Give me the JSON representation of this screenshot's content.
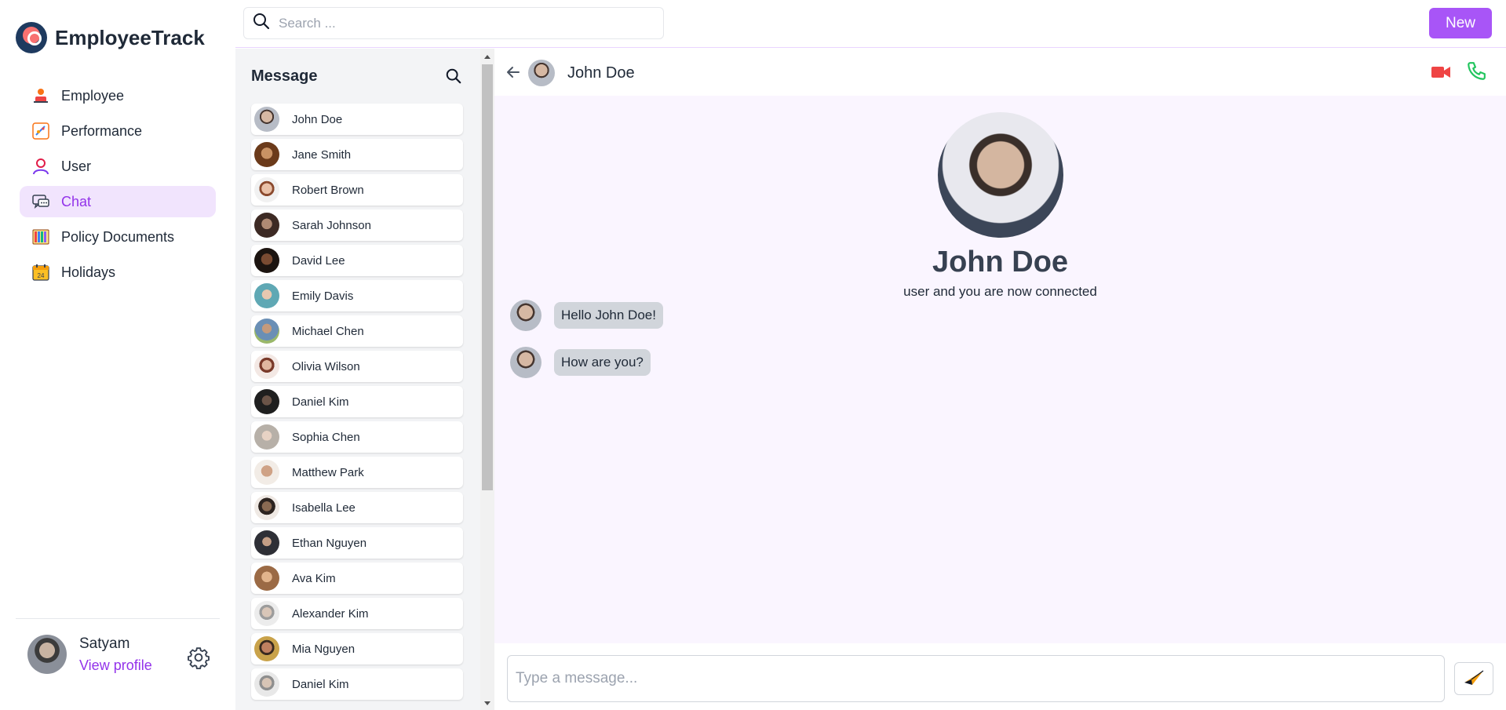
{
  "app": {
    "name": "EmployeeTrack"
  },
  "nav": {
    "items": [
      {
        "label": "Employee",
        "icon": "employee-icon",
        "active": false
      },
      {
        "label": "Performance",
        "icon": "performance-icon",
        "active": false
      },
      {
        "label": "User",
        "icon": "user-icon",
        "active": false
      },
      {
        "label": "Chat",
        "icon": "chat-icon",
        "active": true
      },
      {
        "label": "Policy Documents",
        "icon": "policy-documents-icon",
        "active": false
      },
      {
        "label": "Holidays",
        "icon": "calendar-icon",
        "active": false,
        "icon_text": "24"
      }
    ]
  },
  "profile": {
    "name": "Satyam",
    "link_label": "View profile"
  },
  "topbar": {
    "search_placeholder": "Search ...",
    "new_label": "New"
  },
  "contacts": {
    "title": "Message",
    "list": [
      "John Doe",
      "Jane Smith",
      "Robert Brown",
      "Sarah Johnson",
      "David Lee",
      "Emily Davis",
      "Michael Chen",
      "Olivia Wilson",
      "Daniel Kim",
      "Sophia Chen",
      "Matthew Park",
      "Isabella Lee",
      "Ethan Nguyen",
      "Ava Kim",
      "Alexander Kim",
      "Mia Nguyen",
      "Daniel Kim"
    ]
  },
  "chat": {
    "header_name": "John Doe",
    "profile_name": "John Doe",
    "status": "user and you are now connected",
    "messages": [
      {
        "text": "Hello John Doe!"
      },
      {
        "text": "How are you?"
      }
    ],
    "composer_placeholder": "Type a message..."
  },
  "colors": {
    "accent": "#a855f7",
    "active_text": "#9333ea",
    "active_bg": "#f1e4fd",
    "chat_bg": "#faf5ff",
    "video_icon": "#ef4444",
    "call_icon": "#22c55e"
  }
}
